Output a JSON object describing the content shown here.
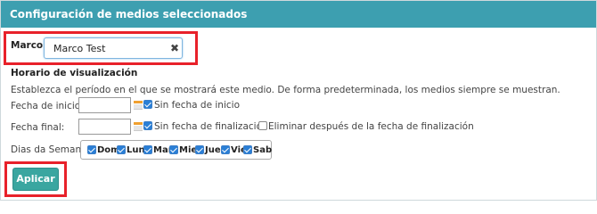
{
  "panel": {
    "title": "Configuración de medios seleccionados"
  },
  "frame": {
    "label": "Marco:",
    "value": "Marco Test",
    "clear_icon": "✖"
  },
  "schedule": {
    "heading": "Horario de visualización",
    "description": "Establezca el período en el que se mostrará este medio. De forma predeterminada, los medios siempre se muestran.",
    "start_label": "Fecha de inicio:",
    "start_value": "",
    "no_start_label": "Sin fecha de inicio",
    "no_start_checked": true,
    "end_label": "Fecha final:",
    "end_value": "",
    "no_end_label": "Sin fecha de finalización",
    "no_end_checked": true,
    "delete_after_label": "Eliminar después de la fecha de finalización",
    "delete_after_checked": false
  },
  "days": {
    "label": "Dias da Semana:",
    "items": [
      {
        "label": "Dom",
        "checked": true
      },
      {
        "label": "Lun",
        "checked": true
      },
      {
        "label": "Mar",
        "checked": true
      },
      {
        "label": "Mie",
        "checked": true
      },
      {
        "label": "Jue",
        "checked": true
      },
      {
        "label": "Vie",
        "checked": true
      },
      {
        "label": "Sab",
        "checked": true
      }
    ]
  },
  "actions": {
    "apply_label": "Aplicar"
  },
  "colors": {
    "header": "#3d9fb0",
    "apply": "#3aa6a0",
    "highlight": "#e8212a",
    "checkbox": "#2a7fd6"
  },
  "icons": {
    "clear": "close-icon",
    "calendar": "calendar-icon"
  }
}
